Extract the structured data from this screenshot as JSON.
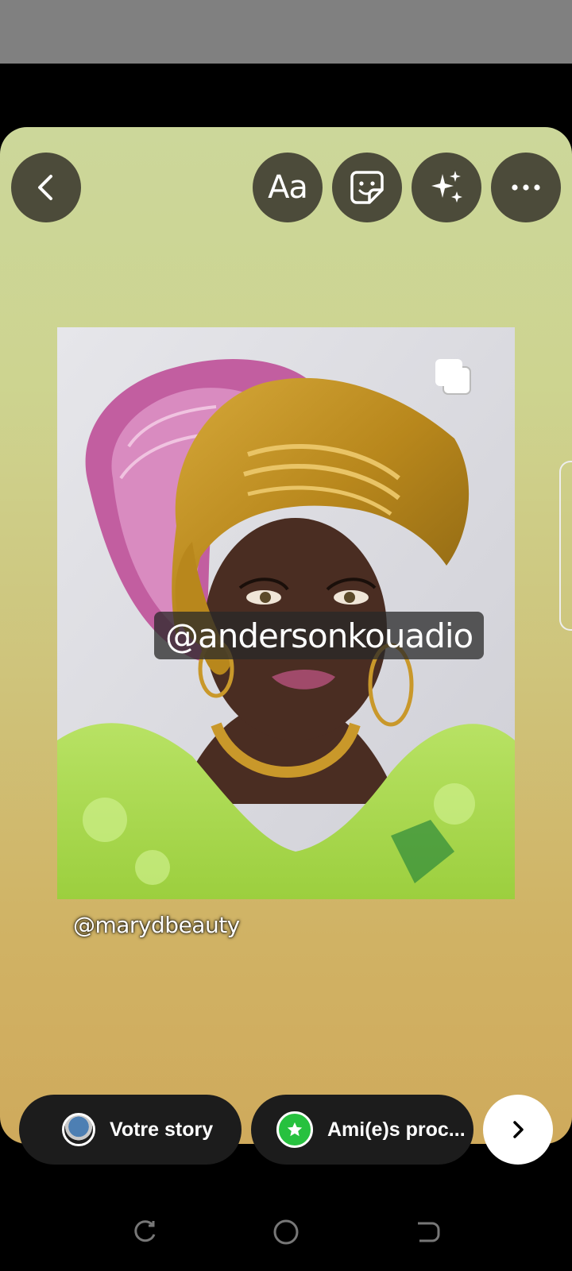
{
  "toolbar": {
    "back_icon": "chevron-left-icon",
    "text_tool_label": "Aa",
    "sticker_icon": "sticker-icon",
    "effects_icon": "sparkles-icon",
    "more_icon": "more-horizontal-icon"
  },
  "canvas": {
    "mention_primary": "@andersonkouadio",
    "mention_secondary": "@marydbeauty",
    "photo_badge_icon": "multiple-photos-icon"
  },
  "share": {
    "your_story_label": "Votre story",
    "close_friends_label": "Ami(e)s proc...",
    "next_icon": "chevron-right-icon"
  },
  "navigation": {
    "recent_icon": "recent-apps-icon",
    "home_icon": "home-icon",
    "back_icon": "back-icon"
  },
  "colors": {
    "button_bg": "#4c4b3a",
    "pill_bg": "#1c1c1c",
    "close_friends_green": "#27c13f"
  }
}
